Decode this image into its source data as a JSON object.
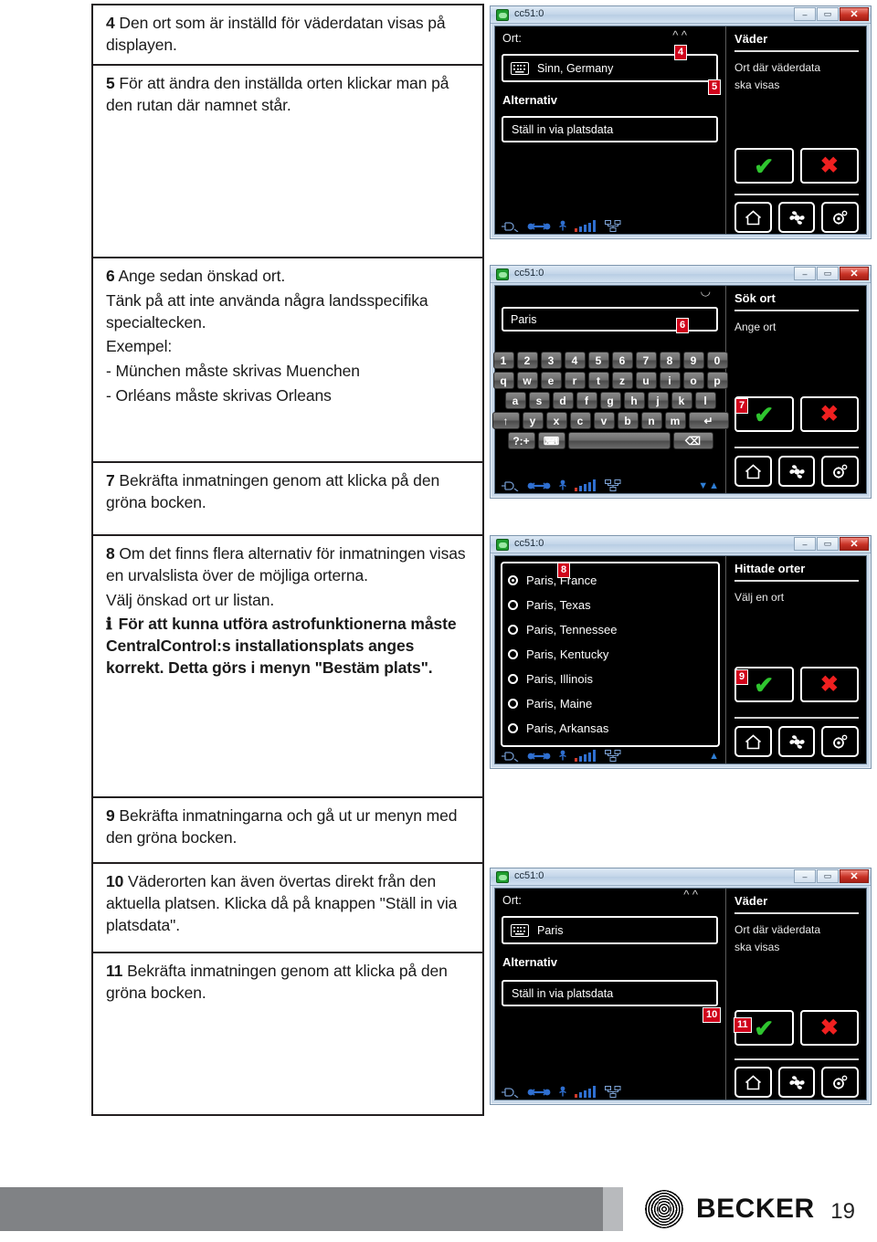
{
  "document": {
    "page_number": "19",
    "brand": "BECKER"
  },
  "instructions": [
    {
      "number": "4",
      "lines": [
        {
          "text": "Den ort som är inställd för väderdatan visas på displayen.",
          "bold": false
        }
      ]
    },
    {
      "number": "5",
      "lines": [
        {
          "text": "För att ändra den inställda orten klickar man på den rutan där namnet står.",
          "bold": false
        }
      ]
    },
    {
      "number": "6",
      "lines": [
        {
          "text": "Ange sedan önskad ort.",
          "bold": false
        },
        {
          "text": "Tänk på att inte använda några landsspecifika specialtecken.",
          "bold": false
        },
        {
          "text": "Exempel:",
          "bold": false
        },
        {
          "text": "- München måste skrivas Muenchen",
          "bold": false
        },
        {
          "text": "- Orléans måste skrivas Orleans",
          "bold": false
        }
      ]
    },
    {
      "number": "7",
      "lines": [
        {
          "text": "Bekräfta inmatningen genom att klicka på den gröna bocken.",
          "bold": false
        }
      ]
    },
    {
      "number": "8",
      "lines": [
        {
          "text": "Om det finns flera alternativ för inmatningen visas en urvalslista över de möjliga orterna.",
          "bold": false
        },
        {
          "text": "Välj önskad ort ur listan.",
          "bold": false
        },
        {
          "text": "För att kunna utföra astrofunktionerna måste CentralControl:s installationsplats anges korrekt. Detta görs i menyn \"Bestäm plats\".",
          "bold": true,
          "info": true
        }
      ]
    },
    {
      "number": "9",
      "lines": [
        {
          "text": "Bekräfta inmatningarna och gå ut ur menyn med den gröna bocken.",
          "bold": false
        }
      ]
    },
    {
      "number": "10",
      "lines": [
        {
          "text": "Väderorten kan även övertas direkt från den aktuella platsen. Klicka då på knappen \"Ställ in via platsdata\".",
          "bold": false
        }
      ]
    },
    {
      "number": "11",
      "lines": [
        {
          "text": "Bekräfta inmatningen genom att klicka på den gröna bocken.",
          "bold": false
        }
      ]
    }
  ],
  "panels": {
    "p1": {
      "window_title": "cc51:0",
      "min_label": "–",
      "max_label": "▭",
      "close_label": "✕",
      "ort_label": "Ort:",
      "location_value": "Sinn, Germany",
      "alternativ_label": "Alternativ",
      "platsdata_button": "Ställ in via platsdata",
      "right_title": "Väder",
      "right_sub_line1": "Ort där väderdata",
      "right_sub_line2": "ska visas",
      "callout_top": "4",
      "callout_field": "5"
    },
    "p2": {
      "window_title": "cc51:0",
      "min_label": "–",
      "max_label": "▭",
      "close_label": "✕",
      "input_value": "Paris",
      "right_title": "Sök ort",
      "right_sub_line1": "Ange ort",
      "callout_input": "6",
      "callout_ok": "7",
      "keyboard_rows": [
        [
          "1",
          "2",
          "3",
          "4",
          "5",
          "6",
          "7",
          "8",
          "9",
          "0"
        ],
        [
          "q",
          "w",
          "e",
          "r",
          "t",
          "z",
          "u",
          "i",
          "o",
          "p"
        ],
        [
          "a",
          "s",
          "d",
          "f",
          "g",
          "h",
          "j",
          "k",
          "l"
        ],
        [
          "↑",
          "y",
          "x",
          "c",
          "v",
          "b",
          "n",
          "m",
          "↵"
        ],
        [
          "?:+",
          "⌨",
          "",
          "⌫"
        ]
      ]
    },
    "p3": {
      "window_title": "cc51:0",
      "min_label": "–",
      "max_label": "▭",
      "close_label": "✕",
      "right_title": "Hittade orter",
      "right_sub_line1": "Välj en ort",
      "callout_list": "8",
      "callout_ok": "9",
      "list_items": [
        {
          "label": "Paris, France",
          "selected": true
        },
        {
          "label": "Paris, Texas",
          "selected": false
        },
        {
          "label": "Paris, Tennessee",
          "selected": false
        },
        {
          "label": "Paris, Kentucky",
          "selected": false
        },
        {
          "label": "Paris, Illinois",
          "selected": false
        },
        {
          "label": "Paris, Maine",
          "selected": false
        },
        {
          "label": "Paris, Arkansas",
          "selected": false
        }
      ]
    },
    "p4": {
      "window_title": "cc51:0",
      "min_label": "–",
      "max_label": "▭",
      "close_label": "✕",
      "ort_label": "Ort:",
      "location_value": "Paris",
      "alternativ_label": "Alternativ",
      "platsdata_button": "Ställ in via platsdata",
      "right_title": "Väder",
      "right_sub_line1": "Ort där väderdata",
      "right_sub_line2": "ska visas",
      "callout_platsdata": "10",
      "callout_ok": "11"
    }
  },
  "colors": {
    "callout_red": "#d0021b",
    "check_green": "#2fc52f",
    "cross_red": "#ef2020",
    "titlebar_blue": "#c4d6e9",
    "footer_gray": "#808285"
  }
}
